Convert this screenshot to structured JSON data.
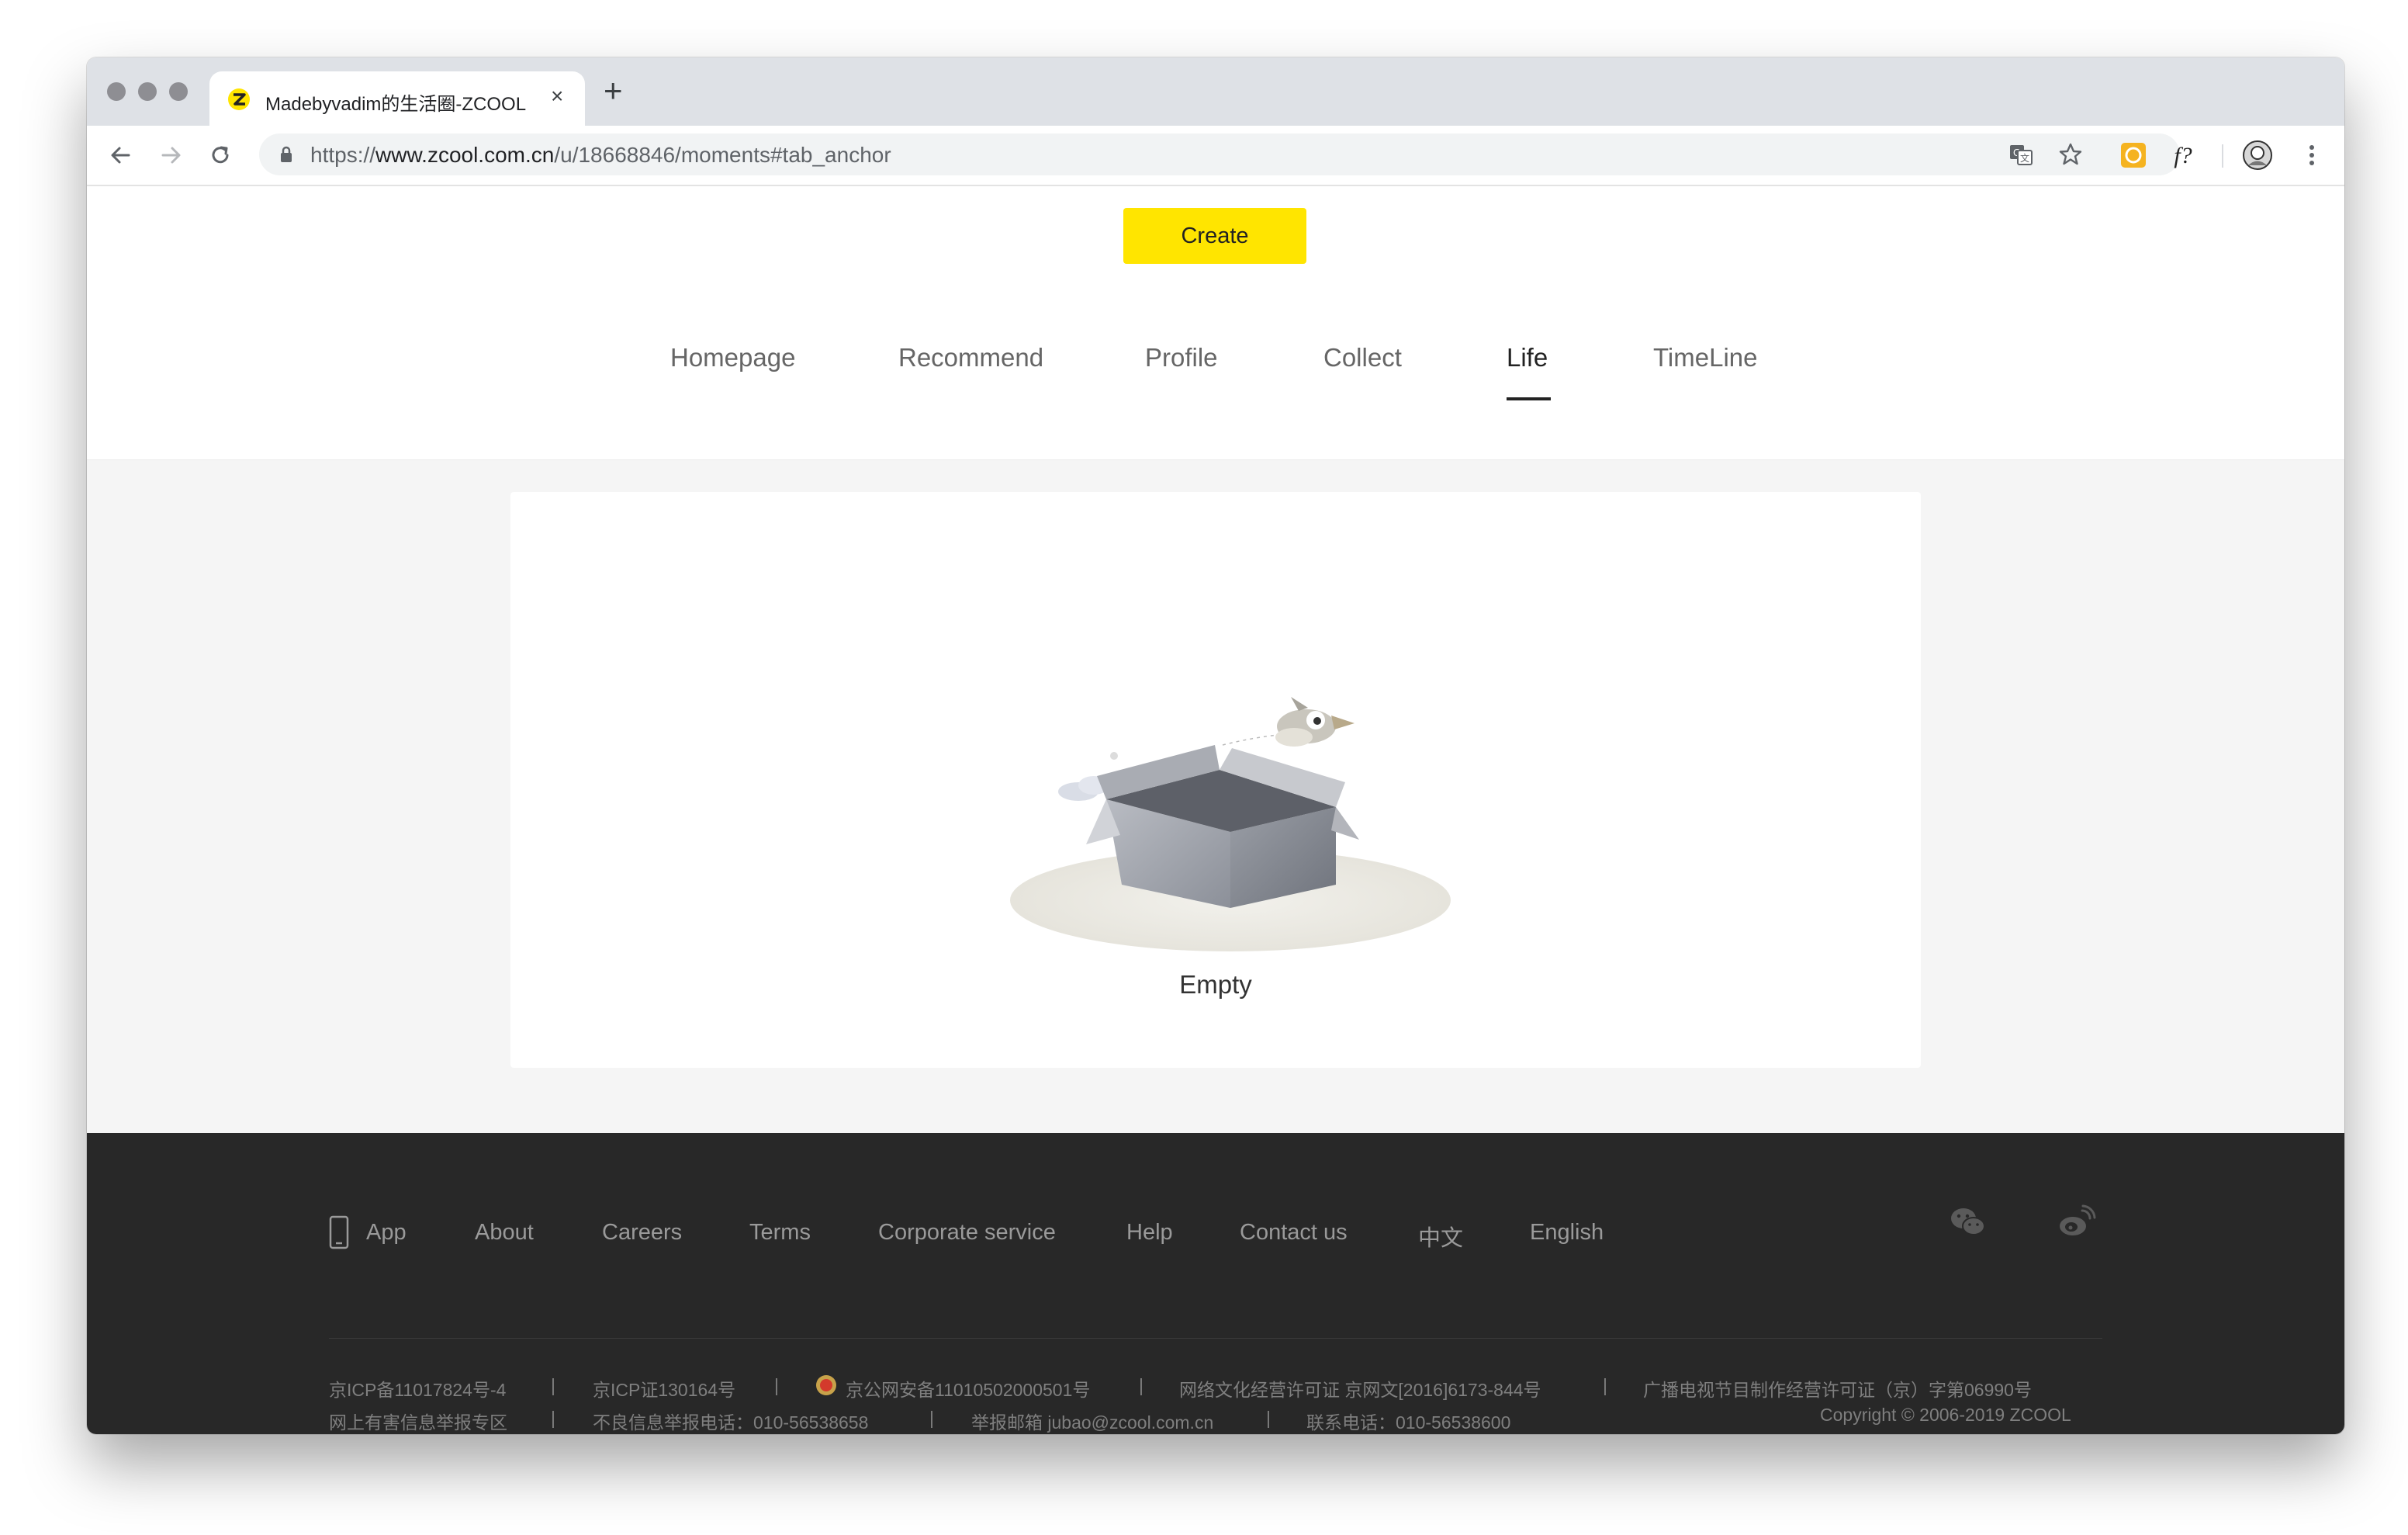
{
  "browser": {
    "tab_title": "Madebyvadim的生活圈-ZCOOL",
    "close_tab": "×",
    "new_tab": "+",
    "url_scheme": "https://",
    "url_host": "www.zcool.com.cn",
    "url_path": "/u/18668846/moments#tab_anchor"
  },
  "header": {
    "create_label": "Create",
    "tabs": [
      {
        "label": "Homepage"
      },
      {
        "label": "Recommend"
      },
      {
        "label": "Profile"
      },
      {
        "label": "Collect"
      },
      {
        "label": "Life"
      },
      {
        "label": "TimeLine"
      }
    ],
    "active_tab": "Life"
  },
  "main": {
    "empty_label": "Empty"
  },
  "footer": {
    "links": [
      {
        "label": "App"
      },
      {
        "label": "About"
      },
      {
        "label": "Careers"
      },
      {
        "label": "Terms"
      },
      {
        "label": "Corporate service"
      },
      {
        "label": "Help"
      },
      {
        "label": "Contact us"
      },
      {
        "label": "中文"
      },
      {
        "label": "English"
      }
    ],
    "social": [
      "wechat-icon",
      "weibo-icon"
    ],
    "legal_row1": [
      "京ICP备11017824号-4",
      "京ICP证130164号",
      "京公网安备11010502000501号",
      "网络文化经营许可证 京网文[2016]6173-844号",
      "广播电视节目制作经营许可证（京）字第06990号"
    ],
    "legal_row2": [
      "网上有害信息举报专区",
      "不良信息举报电话：010-56538658",
      "举报邮箱 jubao@zcool.com.cn",
      "联系电话：010-56538600"
    ],
    "separator": "|",
    "copyright": "Copyright © 2006-2019 ZCOOL"
  },
  "colors": {
    "accent": "#ffe500",
    "footer_bg": "#282828",
    "page_bg": "#f5f5f5"
  }
}
